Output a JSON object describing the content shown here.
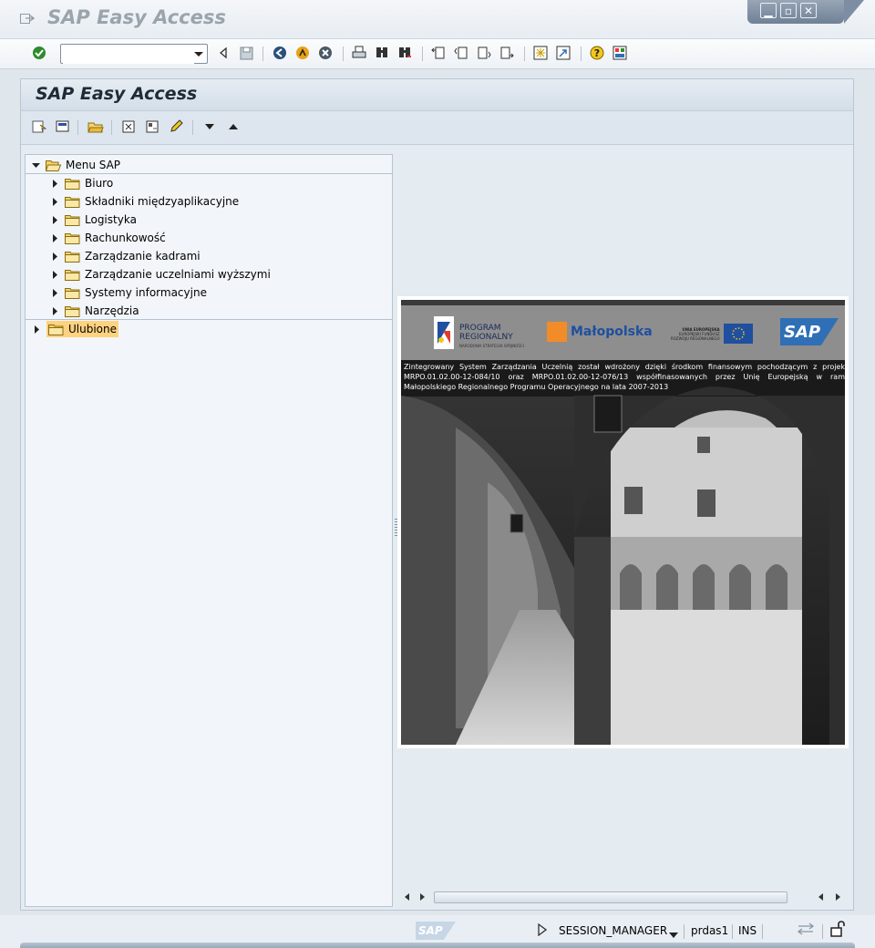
{
  "window": {
    "title": "SAP Easy Access",
    "controls": [
      "minimize",
      "maximize",
      "close"
    ]
  },
  "standard_toolbar": {
    "command_field": {
      "value": "",
      "placeholder": ""
    },
    "buttons": [
      "enter",
      "back",
      "save",
      "back-green",
      "exit",
      "cancel",
      "print",
      "find",
      "find-next",
      "first-page",
      "previous-page",
      "next-page",
      "last-page",
      "create-session",
      "create-shortcut",
      "help",
      "customize-layout"
    ]
  },
  "page": {
    "title": "SAP Easy Access",
    "app_toolbar_buttons": [
      "other-menu",
      "add-to-favorites",
      "delete-favorite",
      "change-favorite",
      "move-down",
      "move-up",
      "create-role",
      "assign-users",
      "documentation",
      "expand",
      "collapse"
    ]
  },
  "tree": {
    "root": {
      "label": "Menu SAP",
      "expanded": true
    },
    "children": [
      {
        "label": "Biuro"
      },
      {
        "label": "Składniki międzyaplikacyjne"
      },
      {
        "label": "Logistyka"
      },
      {
        "label": "Rachunkowość"
      },
      {
        "label": "Zarządzanie kadrami"
      },
      {
        "label": "Zarządzanie uczelniami wyższymi"
      },
      {
        "label": "Systemy informacyjne"
      },
      {
        "label": "Narzędzia"
      }
    ],
    "favorites": {
      "label": "Ulubione",
      "selected": true
    }
  },
  "banner": {
    "logo_program": "PROGRAM\nREGIONALNY",
    "logo_program_sub": "NARODOWA STRATEGIA SPÓJNOŚCI",
    "logo_malopolska": "Małopolska",
    "logo_eu_line1": "UNIA EUROPEJSKA",
    "logo_eu_line2": "EUROPEJSKI FUNDUSZ\nROZWOJU REGIONALNEGO",
    "logo_sap": "SAP",
    "text": "Zintegrowany System Zarządzania Uczelnią został wdrożony dzięki środkom finansowym pochodzącym z projek MRPO.01.02.00-12-084/10 oraz MRPO.01.02.00-12-076/13 współfinasowanych przez Unię Europejską w ram Małopolskiego Regionalnego Programu Operacyjnego na lata 2007-2013"
  },
  "status_bar": {
    "logo": "SAP",
    "transaction": "SESSION_MANAGER",
    "server": "prdas1",
    "mode": "INS"
  },
  "colors": {
    "selection": "#ffd27f",
    "title_text": "#1f2a36",
    "sap_blue": "#2f6fb6"
  }
}
